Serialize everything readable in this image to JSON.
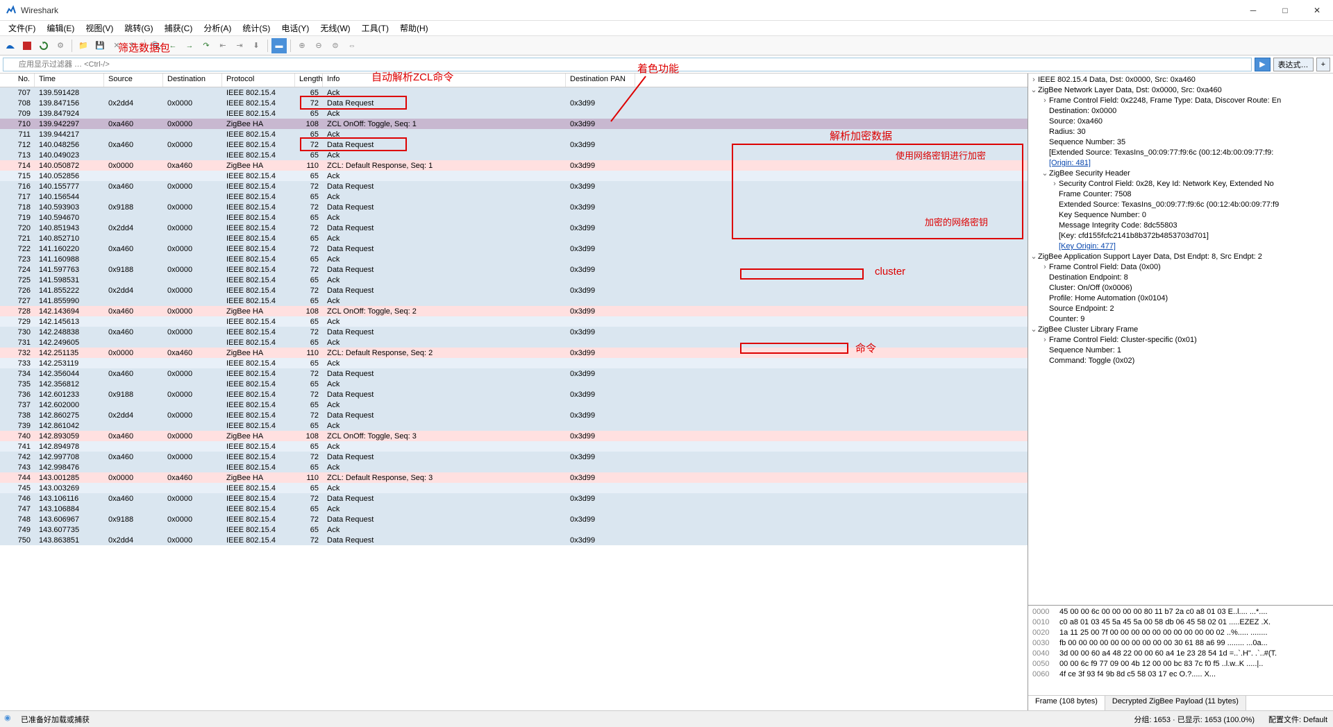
{
  "title": "Wireshark",
  "menu": [
    "文件(F)",
    "编辑(E)",
    "视图(V)",
    "跳转(G)",
    "捕获(C)",
    "分析(A)",
    "统计(S)",
    "电话(Y)",
    "无线(W)",
    "工具(T)",
    "帮助(H)"
  ],
  "filter_placeholder": "应用显示过滤器 … <Ctrl-/>",
  "filter_btn": "表达式…",
  "columns": [
    "No.",
    "Time",
    "Source",
    "Destination",
    "Protocol",
    "Length",
    "Info",
    "Destination PAN"
  ],
  "packets": [
    {
      "no": "707",
      "t": "139.591428",
      "s": "",
      "d": "",
      "p": "IEEE 802.15.4",
      "l": "65",
      "i": "Ack",
      "pan": "",
      "cls": "bg-blue"
    },
    {
      "no": "708",
      "t": "139.847156",
      "s": "0x2dd4",
      "d": "0x0000",
      "p": "IEEE 802.15.4",
      "l": "72",
      "i": "Data Request",
      "pan": "0x3d99",
      "cls": "bg-blue"
    },
    {
      "no": "709",
      "t": "139.847924",
      "s": "",
      "d": "",
      "p": "IEEE 802.15.4",
      "l": "65",
      "i": "Ack",
      "pan": "",
      "cls": "bg-blue"
    },
    {
      "no": "710",
      "t": "139.942297",
      "s": "0xa460",
      "d": "0x0000",
      "p": "ZigBee HA",
      "l": "108",
      "i": "ZCL OnOff: Toggle, Seq: 1",
      "pan": "0x3d99",
      "cls": "bg-sel"
    },
    {
      "no": "711",
      "t": "139.944217",
      "s": "",
      "d": "",
      "p": "IEEE 802.15.4",
      "l": "65",
      "i": "Ack",
      "pan": "",
      "cls": "bg-blue"
    },
    {
      "no": "712",
      "t": "140.048256",
      "s": "0xa460",
      "d": "0x0000",
      "p": "IEEE 802.15.4",
      "l": "72",
      "i": "Data Request",
      "pan": "0x3d99",
      "cls": "bg-blue"
    },
    {
      "no": "713",
      "t": "140.049023",
      "s": "",
      "d": "",
      "p": "IEEE 802.15.4",
      "l": "65",
      "i": "Ack",
      "pan": "",
      "cls": "bg-blue"
    },
    {
      "no": "714",
      "t": "140.050872",
      "s": "0x0000",
      "d": "0xa460",
      "p": "ZigBee HA",
      "l": "110",
      "i": "ZCL: Default Response, Seq: 1",
      "pan": "0x3d99",
      "cls": "bg-pink"
    },
    {
      "no": "715",
      "t": "140.052856",
      "s": "",
      "d": "",
      "p": "IEEE 802.15.4",
      "l": "65",
      "i": "Ack",
      "pan": "",
      "cls": "bg-lightblue"
    },
    {
      "no": "716",
      "t": "140.155777",
      "s": "0xa460",
      "d": "0x0000",
      "p": "IEEE 802.15.4",
      "l": "72",
      "i": "Data Request",
      "pan": "0x3d99",
      "cls": "bg-blue"
    },
    {
      "no": "717",
      "t": "140.156544",
      "s": "",
      "d": "",
      "p": "IEEE 802.15.4",
      "l": "65",
      "i": "Ack",
      "pan": "",
      "cls": "bg-blue"
    },
    {
      "no": "718",
      "t": "140.593903",
      "s": "0x9188",
      "d": "0x0000",
      "p": "IEEE 802.15.4",
      "l": "72",
      "i": "Data Request",
      "pan": "0x3d99",
      "cls": "bg-blue"
    },
    {
      "no": "719",
      "t": "140.594670",
      "s": "",
      "d": "",
      "p": "IEEE 802.15.4",
      "l": "65",
      "i": "Ack",
      "pan": "",
      "cls": "bg-blue"
    },
    {
      "no": "720",
      "t": "140.851943",
      "s": "0x2dd4",
      "d": "0x0000",
      "p": "IEEE 802.15.4",
      "l": "72",
      "i": "Data Request",
      "pan": "0x3d99",
      "cls": "bg-blue"
    },
    {
      "no": "721",
      "t": "140.852710",
      "s": "",
      "d": "",
      "p": "IEEE 802.15.4",
      "l": "65",
      "i": "Ack",
      "pan": "",
      "cls": "bg-blue"
    },
    {
      "no": "722",
      "t": "141.160220",
      "s": "0xa460",
      "d": "0x0000",
      "p": "IEEE 802.15.4",
      "l": "72",
      "i": "Data Request",
      "pan": "0x3d99",
      "cls": "bg-blue"
    },
    {
      "no": "723",
      "t": "141.160988",
      "s": "",
      "d": "",
      "p": "IEEE 802.15.4",
      "l": "65",
      "i": "Ack",
      "pan": "",
      "cls": "bg-blue"
    },
    {
      "no": "724",
      "t": "141.597763",
      "s": "0x9188",
      "d": "0x0000",
      "p": "IEEE 802.15.4",
      "l": "72",
      "i": "Data Request",
      "pan": "0x3d99",
      "cls": "bg-blue"
    },
    {
      "no": "725",
      "t": "141.598531",
      "s": "",
      "d": "",
      "p": "IEEE 802.15.4",
      "l": "65",
      "i": "Ack",
      "pan": "",
      "cls": "bg-blue"
    },
    {
      "no": "726",
      "t": "141.855222",
      "s": "0x2dd4",
      "d": "0x0000",
      "p": "IEEE 802.15.4",
      "l": "72",
      "i": "Data Request",
      "pan": "0x3d99",
      "cls": "bg-blue"
    },
    {
      "no": "727",
      "t": "141.855990",
      "s": "",
      "d": "",
      "p": "IEEE 802.15.4",
      "l": "65",
      "i": "Ack",
      "pan": "",
      "cls": "bg-blue"
    },
    {
      "no": "728",
      "t": "142.143694",
      "s": "0xa460",
      "d": "0x0000",
      "p": "ZigBee HA",
      "l": "108",
      "i": "ZCL OnOff: Toggle, Seq: 2",
      "pan": "0x3d99",
      "cls": "bg-pink"
    },
    {
      "no": "729",
      "t": "142.145613",
      "s": "",
      "d": "",
      "p": "IEEE 802.15.4",
      "l": "65",
      "i": "Ack",
      "pan": "",
      "cls": "bg-lightblue"
    },
    {
      "no": "730",
      "t": "142.248838",
      "s": "0xa460",
      "d": "0x0000",
      "p": "IEEE 802.15.4",
      "l": "72",
      "i": "Data Request",
      "pan": "0x3d99",
      "cls": "bg-blue"
    },
    {
      "no": "731",
      "t": "142.249605",
      "s": "",
      "d": "",
      "p": "IEEE 802.15.4",
      "l": "65",
      "i": "Ack",
      "pan": "",
      "cls": "bg-blue"
    },
    {
      "no": "732",
      "t": "142.251135",
      "s": "0x0000",
      "d": "0xa460",
      "p": "ZigBee HA",
      "l": "110",
      "i": "ZCL: Default Response, Seq: 2",
      "pan": "0x3d99",
      "cls": "bg-pink"
    },
    {
      "no": "733",
      "t": "142.253119",
      "s": "",
      "d": "",
      "p": "IEEE 802.15.4",
      "l": "65",
      "i": "Ack",
      "pan": "",
      "cls": "bg-lightblue"
    },
    {
      "no": "734",
      "t": "142.356044",
      "s": "0xa460",
      "d": "0x0000",
      "p": "IEEE 802.15.4",
      "l": "72",
      "i": "Data Request",
      "pan": "0x3d99",
      "cls": "bg-blue"
    },
    {
      "no": "735",
      "t": "142.356812",
      "s": "",
      "d": "",
      "p": "IEEE 802.15.4",
      "l": "65",
      "i": "Ack",
      "pan": "",
      "cls": "bg-blue"
    },
    {
      "no": "736",
      "t": "142.601233",
      "s": "0x9188",
      "d": "0x0000",
      "p": "IEEE 802.15.4",
      "l": "72",
      "i": "Data Request",
      "pan": "0x3d99",
      "cls": "bg-blue"
    },
    {
      "no": "737",
      "t": "142.602000",
      "s": "",
      "d": "",
      "p": "IEEE 802.15.4",
      "l": "65",
      "i": "Ack",
      "pan": "",
      "cls": "bg-blue"
    },
    {
      "no": "738",
      "t": "142.860275",
      "s": "0x2dd4",
      "d": "0x0000",
      "p": "IEEE 802.15.4",
      "l": "72",
      "i": "Data Request",
      "pan": "0x3d99",
      "cls": "bg-blue"
    },
    {
      "no": "739",
      "t": "142.861042",
      "s": "",
      "d": "",
      "p": "IEEE 802.15.4",
      "l": "65",
      "i": "Ack",
      "pan": "",
      "cls": "bg-blue"
    },
    {
      "no": "740",
      "t": "142.893059",
      "s": "0xa460",
      "d": "0x0000",
      "p": "ZigBee HA",
      "l": "108",
      "i": "ZCL OnOff: Toggle, Seq: 3",
      "pan": "0x3d99",
      "cls": "bg-pink"
    },
    {
      "no": "741",
      "t": "142.894978",
      "s": "",
      "d": "",
      "p": "IEEE 802.15.4",
      "l": "65",
      "i": "Ack",
      "pan": "",
      "cls": "bg-lightblue"
    },
    {
      "no": "742",
      "t": "142.997708",
      "s": "0xa460",
      "d": "0x0000",
      "p": "IEEE 802.15.4",
      "l": "72",
      "i": "Data Request",
      "pan": "0x3d99",
      "cls": "bg-blue"
    },
    {
      "no": "743",
      "t": "142.998476",
      "s": "",
      "d": "",
      "p": "IEEE 802.15.4",
      "l": "65",
      "i": "Ack",
      "pan": "",
      "cls": "bg-blue"
    },
    {
      "no": "744",
      "t": "143.001285",
      "s": "0x0000",
      "d": "0xa460",
      "p": "ZigBee HA",
      "l": "110",
      "i": "ZCL: Default Response, Seq: 3",
      "pan": "0x3d99",
      "cls": "bg-pink"
    },
    {
      "no": "745",
      "t": "143.003269",
      "s": "",
      "d": "",
      "p": "IEEE 802.15.4",
      "l": "65",
      "i": "Ack",
      "pan": "",
      "cls": "bg-lightblue"
    },
    {
      "no": "746",
      "t": "143.106116",
      "s": "0xa460",
      "d": "0x0000",
      "p": "IEEE 802.15.4",
      "l": "72",
      "i": "Data Request",
      "pan": "0x3d99",
      "cls": "bg-blue"
    },
    {
      "no": "747",
      "t": "143.106884",
      "s": "",
      "d": "",
      "p": "IEEE 802.15.4",
      "l": "65",
      "i": "Ack",
      "pan": "",
      "cls": "bg-blue"
    },
    {
      "no": "748",
      "t": "143.606967",
      "s": "0x9188",
      "d": "0x0000",
      "p": "IEEE 802.15.4",
      "l": "72",
      "i": "Data Request",
      "pan": "0x3d99",
      "cls": "bg-blue"
    },
    {
      "no": "749",
      "t": "143.607735",
      "s": "",
      "d": "",
      "p": "IEEE 802.15.4",
      "l": "65",
      "i": "Ack",
      "pan": "",
      "cls": "bg-blue"
    },
    {
      "no": "750",
      "t": "143.863851",
      "s": "0x2dd4",
      "d": "0x0000",
      "p": "IEEE 802.15.4",
      "l": "72",
      "i": "Data Request",
      "pan": "0x3d99",
      "cls": "bg-blue"
    }
  ],
  "tree": [
    {
      "lvl": 0,
      "exp": ">",
      "txt": "IEEE 802.15.4 Data, Dst: 0x0000, Src: 0xa460"
    },
    {
      "lvl": 0,
      "exp": "v",
      "txt": "ZigBee Network Layer Data, Dst: 0x0000, Src: 0xa460"
    },
    {
      "lvl": 1,
      "exp": ">",
      "txt": "Frame Control Field: 0x2248, Frame Type: Data, Discover Route: En"
    },
    {
      "lvl": 1,
      "exp": "",
      "txt": "Destination: 0x0000"
    },
    {
      "lvl": 1,
      "exp": "",
      "txt": "Source: 0xa460"
    },
    {
      "lvl": 1,
      "exp": "",
      "txt": "Radius: 30"
    },
    {
      "lvl": 1,
      "exp": "",
      "txt": "Sequence Number: 35"
    },
    {
      "lvl": 1,
      "exp": "",
      "txt": "[Extended Source: TexasIns_00:09:77:f9:6c (00:12:4b:00:09:77:f9:"
    },
    {
      "lvl": 1,
      "exp": "",
      "txt": "[Origin: 481]",
      "link": true
    },
    {
      "lvl": 1,
      "exp": "v",
      "txt": "ZigBee Security Header"
    },
    {
      "lvl": 2,
      "exp": ">",
      "txt": "Security Control Field: 0x28, Key Id: Network Key, Extended No"
    },
    {
      "lvl": 2,
      "exp": "",
      "txt": "Frame Counter: 7508"
    },
    {
      "lvl": 2,
      "exp": "",
      "txt": "Extended Source: TexasIns_00:09:77:f9:6c (00:12:4b:00:09:77:f9"
    },
    {
      "lvl": 2,
      "exp": "",
      "txt": "Key Sequence Number: 0"
    },
    {
      "lvl": 2,
      "exp": "",
      "txt": "Message Integrity Code: 8dc55803"
    },
    {
      "lvl": 2,
      "exp": "",
      "txt": "[Key: cfd155fcfc2141b8b372b4853703d701]"
    },
    {
      "lvl": 2,
      "exp": "",
      "txt": "[Key Origin: 477]",
      "link": true
    },
    {
      "lvl": 0,
      "exp": "v",
      "txt": "ZigBee Application Support Layer Data, Dst Endpt: 8, Src Endpt: 2"
    },
    {
      "lvl": 1,
      "exp": ">",
      "txt": "Frame Control Field: Data (0x00)"
    },
    {
      "lvl": 1,
      "exp": "",
      "txt": "Destination Endpoint: 8"
    },
    {
      "lvl": 1,
      "exp": "",
      "txt": "Cluster: On/Off (0x0006)"
    },
    {
      "lvl": 1,
      "exp": "",
      "txt": "Profile: Home Automation (0x0104)"
    },
    {
      "lvl": 1,
      "exp": "",
      "txt": "Source Endpoint: 2"
    },
    {
      "lvl": 1,
      "exp": "",
      "txt": "Counter: 9"
    },
    {
      "lvl": 0,
      "exp": "v",
      "txt": "ZigBee Cluster Library Frame"
    },
    {
      "lvl": 1,
      "exp": ">",
      "txt": "Frame Control Field: Cluster-specific (0x01)"
    },
    {
      "lvl": 1,
      "exp": "",
      "txt": "Sequence Number: 1"
    },
    {
      "lvl": 1,
      "exp": "",
      "txt": "Command: Toggle (0x02)"
    }
  ],
  "hex": [
    {
      "off": "0000",
      "h": "45 00 00 6c 00 00 00 00  80 11 b7 2a c0 a8 01 03",
      "a": "E..l.... ...*...."
    },
    {
      "off": "0010",
      "h": "c0 a8 01 03 45 5a 45 5a  00 58 db 06 45 58 02 01",
      "a": ".....EZEZ .X."
    },
    {
      "off": "0020",
      "h": "1a 11 25 00 7f 00 00 00  00 00 00 00 00 00 00 02",
      "a": "..%..... ........"
    },
    {
      "off": "0030",
      "h": "fb 00 00 00 00 00 00 00  00 00 00 30 61 88 a6 99",
      "a": "........ ...0a..."
    },
    {
      "off": "0040",
      "h": "3d 00 00 60 a4 48 22 00  00 60 a4 1e 23 28 54 1d",
      "a": "=..`.H\". .`..#(T."
    },
    {
      "off": "0050",
      "h": "00 00 6c f9 77 09 00 4b  12 00 00 bc 83 7c f0 f5",
      "a": "..l.w..K .....|.."
    },
    {
      "off": "0060",
      "h": "4f ce 3f 93 f4 9b 8d c5  58 03 17 ec",
      "a": "O.?..... X..."
    }
  ],
  "tabs": [
    "Frame (108 bytes)",
    "Decrypted ZigBee Payload (11 bytes)"
  ],
  "status_left": "已准备好加载或捕获",
  "status_mid": "分组: 1653 · 已显示: 1653 (100.0%)",
  "status_right": "配置文件: Default",
  "annotations": {
    "filter": "筛选数据包",
    "zcl": "自动解析ZCL命令",
    "color": "着色功能",
    "decrypt": "解析加密数据",
    "netkey": "使用网络密钥进行加密",
    "enckey": "加密的网络密钥",
    "cluster": "cluster",
    "cmd": "命令"
  }
}
